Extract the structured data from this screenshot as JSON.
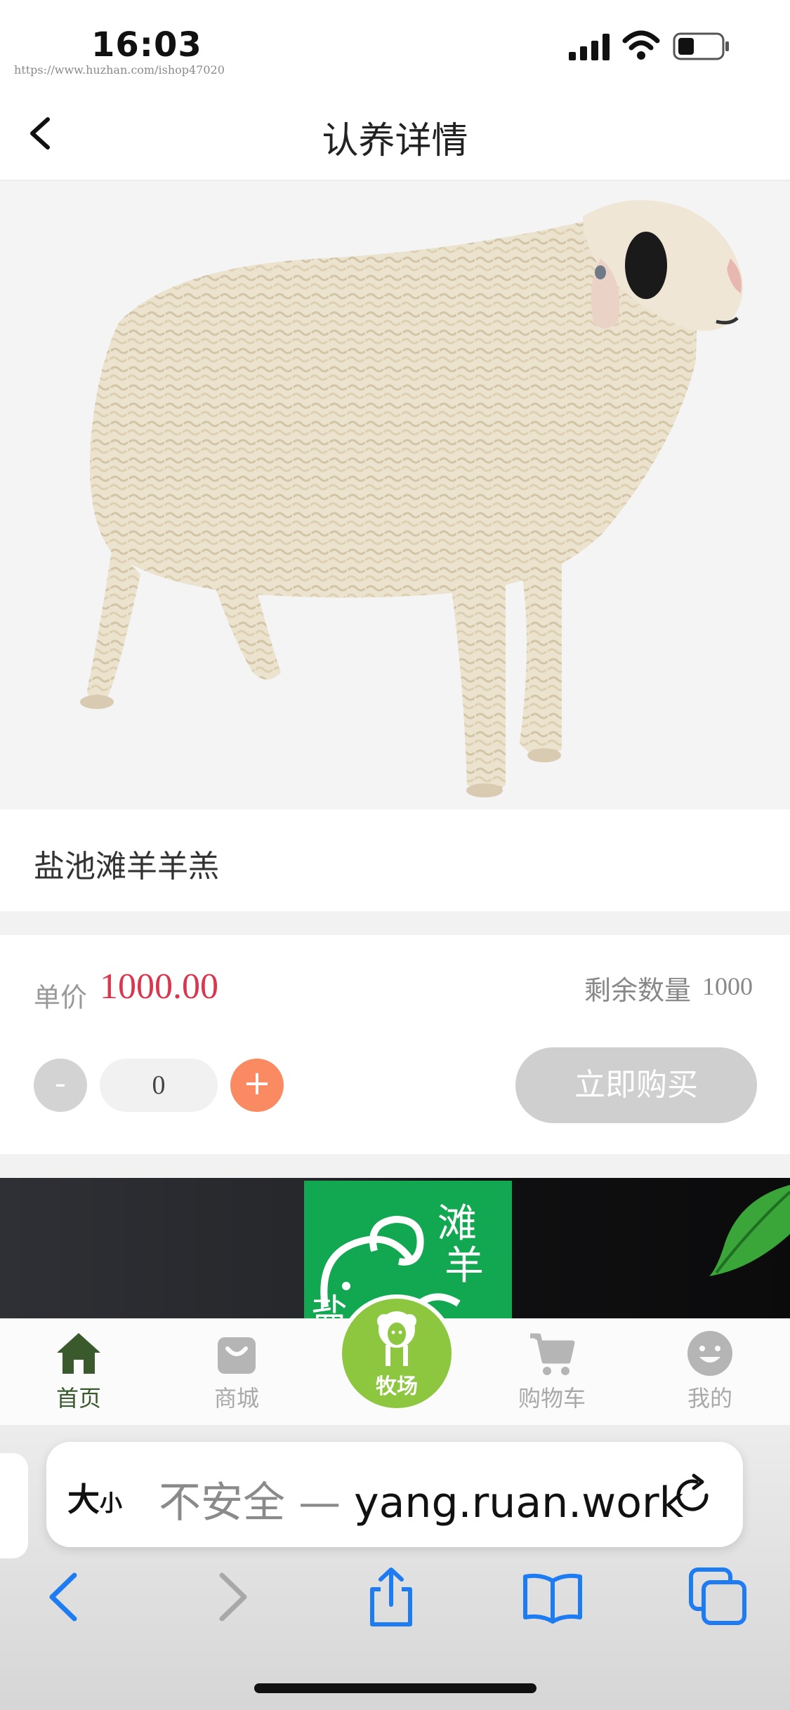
{
  "status_bar": {
    "time": "16:03",
    "watermark": "https://www.huzhan.com/ishop47020"
  },
  "nav": {
    "title": "认养详情"
  },
  "product": {
    "name": "盐池滩羊羊羔",
    "price_label": "单价",
    "price": "1000.00",
    "stock_label": "剩余数量",
    "stock": "1000",
    "quantity": "0",
    "minus": "-",
    "plus": "+",
    "buy_label": "立即购买"
  },
  "banner": {
    "logo_text": [
      "滩",
      "羊",
      "盐"
    ]
  },
  "tab_bar": {
    "active_color": "#3a5a2e",
    "inactive_color": "#a9a9a9",
    "ranch_color": "#8dc63f",
    "items": [
      {
        "label": "首页",
        "icon": "home-icon"
      },
      {
        "label": "商城",
        "icon": "shopping-bag-icon"
      },
      {
        "label": "牧场",
        "icon": "sheep-icon"
      },
      {
        "label": "购物车",
        "icon": "cart-icon"
      },
      {
        "label": "我的",
        "icon": "smiley-icon"
      }
    ]
  },
  "browser": {
    "text_size_big": "大",
    "text_size_small": "小",
    "insecure_label": "不安全 — ",
    "domain_fragment": "yang.ruan.work",
    "accent_color": "#1e7cf2"
  },
  "colors": {
    "price": "#d9364f",
    "plus_button": "#f98a61",
    "buy_button_disabled": "#cfcfcf",
    "banner_logo": "#11a851"
  }
}
